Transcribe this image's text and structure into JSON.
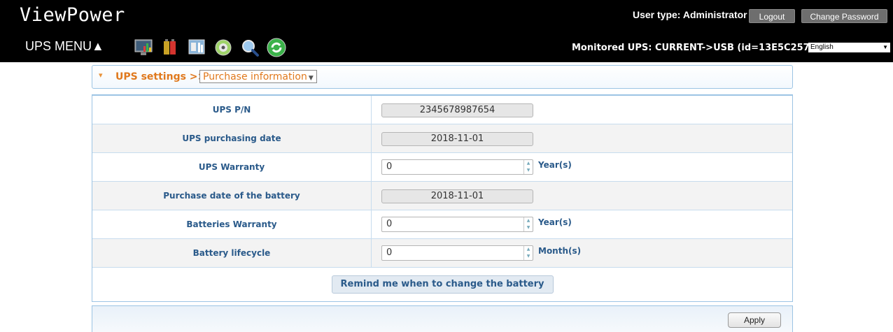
{
  "header": {
    "app_title": "ViewPower",
    "menu_label": "UPS MENU▲",
    "user_type": "User type: Administrator",
    "logout_label": "Logout",
    "change_password_label": "Change Password",
    "monitored_ups": "Monitored UPS: CURRENT->USB (id=13E5C257_PMV)",
    "language": "English",
    "toolbar_icons": [
      "monitor-icon",
      "battery-icon",
      "configuration-icon",
      "cd-icon",
      "search-icon",
      "refresh-icon"
    ]
  },
  "settings": {
    "label": "UPS settings >>",
    "section": "Purchase information"
  },
  "rows": [
    {
      "label": "UPS P/N",
      "value": "2345678987654"
    },
    {
      "label": "UPS purchasing date",
      "value": "2018-11-01"
    },
    {
      "label": "UPS Warranty",
      "value": "0",
      "unit": "Year(s)"
    },
    {
      "label": "Purchase date of the battery",
      "value": "2018-11-01"
    },
    {
      "label": "Batteries Warranty",
      "value": "0",
      "unit": "Year(s)"
    },
    {
      "label": "Battery lifecycle",
      "value": "0",
      "unit": "Month(s)"
    }
  ],
  "remind_button": "Remind me when to change the battery",
  "apply_label": "Apply"
}
